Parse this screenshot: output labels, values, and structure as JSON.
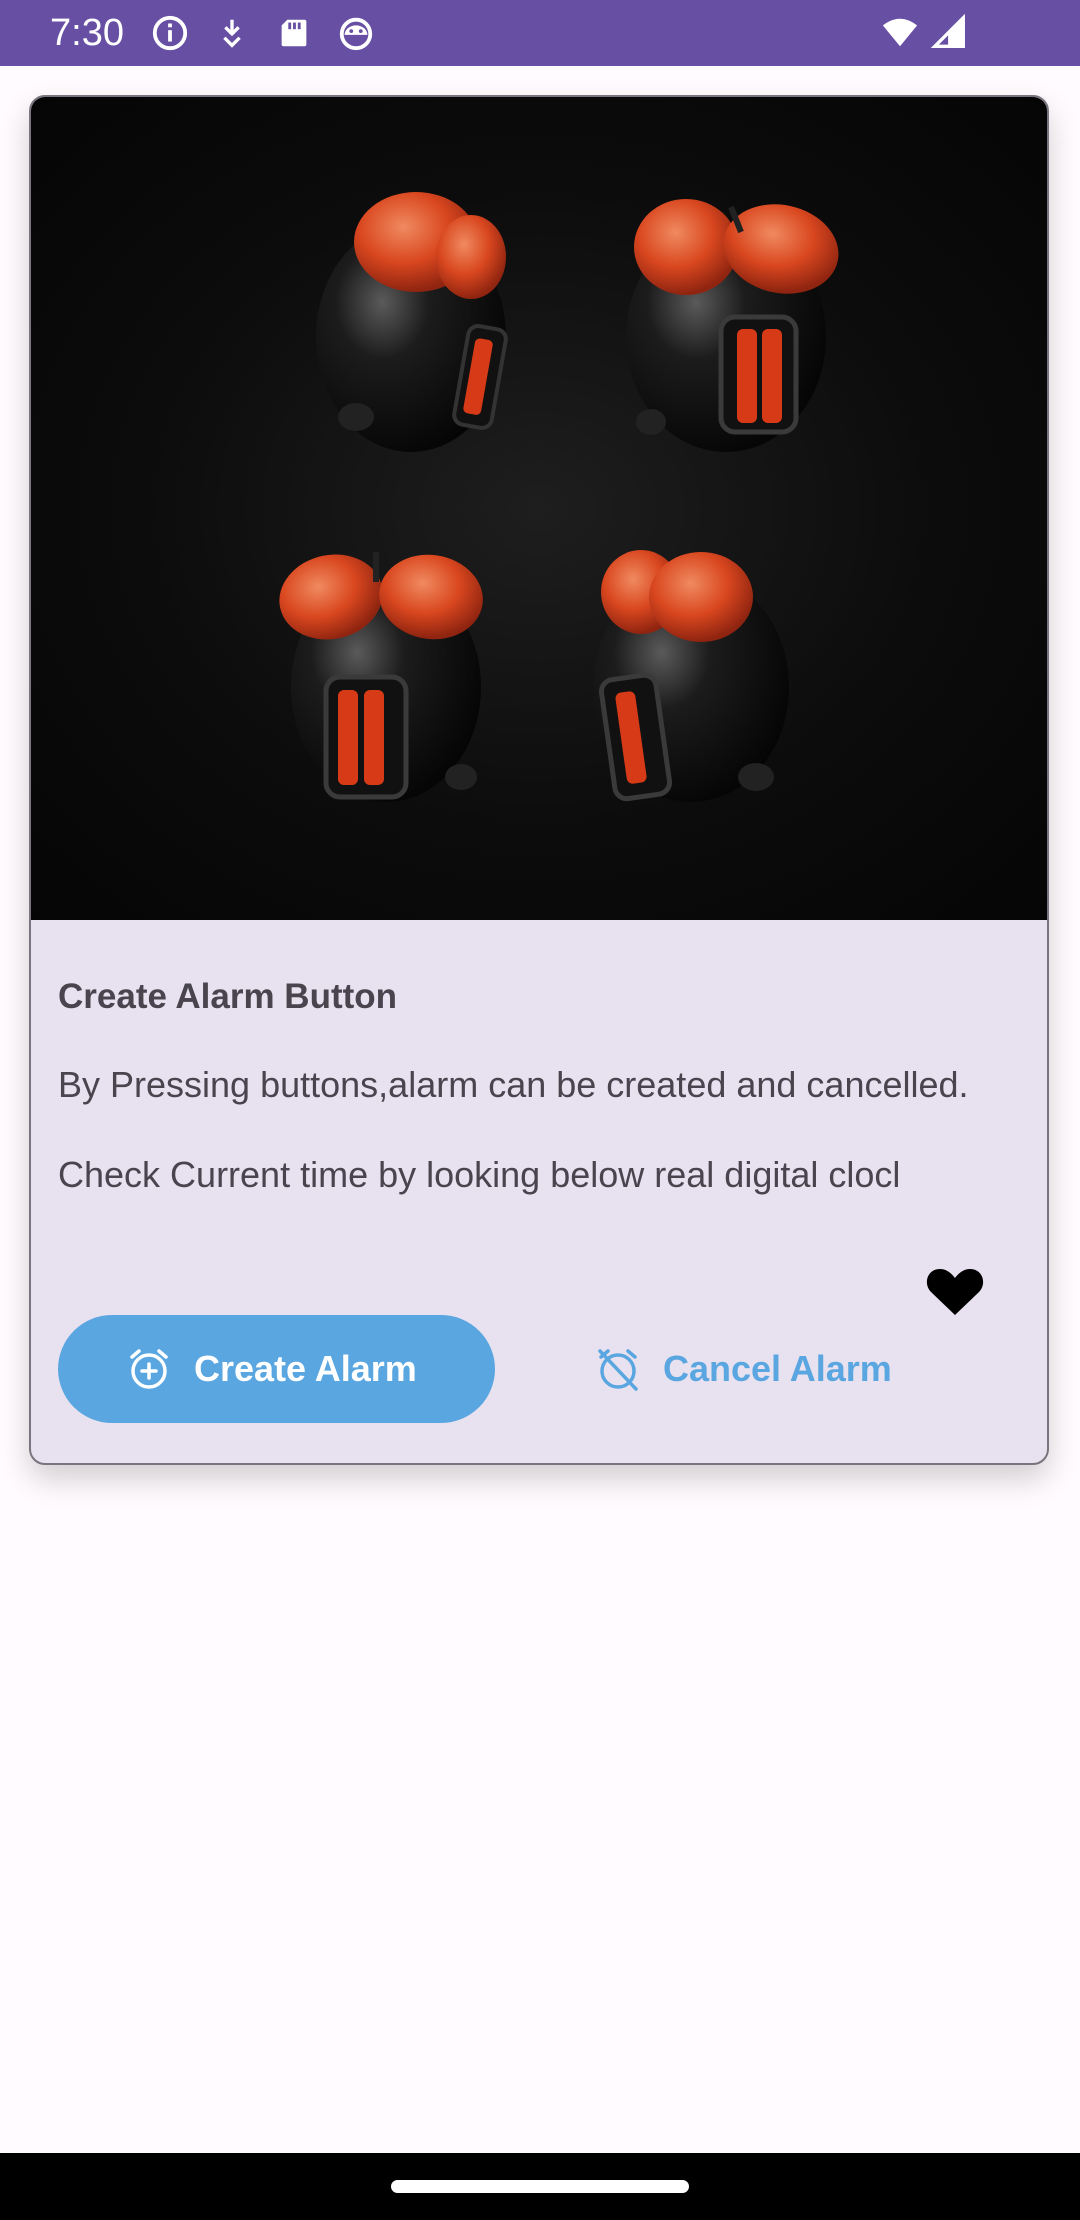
{
  "status_bar": {
    "time": "7:30",
    "left_icons": [
      "info-icon",
      "download-icon",
      "sd-card-icon",
      "android-debug-icon"
    ],
    "right_icons": [
      "wifi-icon",
      "signal-icon"
    ],
    "background": "#6750a4"
  },
  "card": {
    "image": "alarm-clocks-image",
    "title": "Create Alarm Button",
    "body": "By Pressing buttons,alarm can be created and cancelled.\n\nCheck Current time by looking below real digital clocl",
    "favorite_icon": "heart-icon",
    "create_button": {
      "label": "Create Alarm",
      "icon": "alarm-add-icon"
    },
    "cancel_button": {
      "label": "Cancel Alarm",
      "icon": "alarm-off-icon"
    }
  },
  "colors": {
    "accent": "#5aa6e0",
    "card_background": "#e8e1ef",
    "text": "#49454f"
  }
}
